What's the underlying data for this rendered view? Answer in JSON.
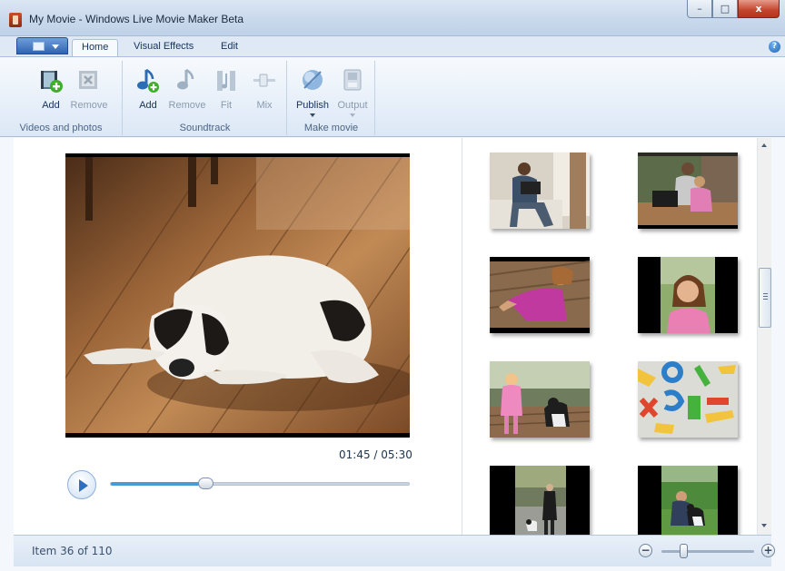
{
  "window": {
    "title": "My Movie - Windows Live Movie Maker Beta",
    "controls": {
      "minimize": "–",
      "maximize": "□",
      "close": "x"
    }
  },
  "ribbon": {
    "tabs": [
      {
        "label": "Home",
        "active": true
      },
      {
        "label": "Visual Effects",
        "active": false
      },
      {
        "label": "Edit",
        "active": false
      }
    ],
    "help": "?",
    "groups": {
      "videos_photos": {
        "label": "Videos and photos",
        "add": "Add",
        "remove": "Remove"
      },
      "soundtrack": {
        "label": "Soundtrack",
        "add": "Add",
        "remove": "Remove",
        "fit": "Fit",
        "mix": "Mix"
      },
      "make_movie": {
        "label": "Make movie",
        "publish": "Publish",
        "output": "Output"
      }
    }
  },
  "player": {
    "time": "01:45 / 05:30",
    "progress": 0.318
  },
  "storyboard": {
    "thumbnails": [
      "man-with-laptop",
      "mother-and-child-with-laptop",
      "girl-on-deck",
      "girl-smiling",
      "girl-with-dog",
      "colorful-letters",
      "person-walking-dog",
      "person-with-dog-on-grass"
    ]
  },
  "status": {
    "text": "Item 36 of 110",
    "zoom_level": 0.24,
    "zoom_out": "−",
    "zoom_in": "+"
  },
  "colors": {
    "ribbon_accent": "#2f63b3",
    "seek_fill": "#4a9ad8",
    "close_button": "#c3432c"
  }
}
